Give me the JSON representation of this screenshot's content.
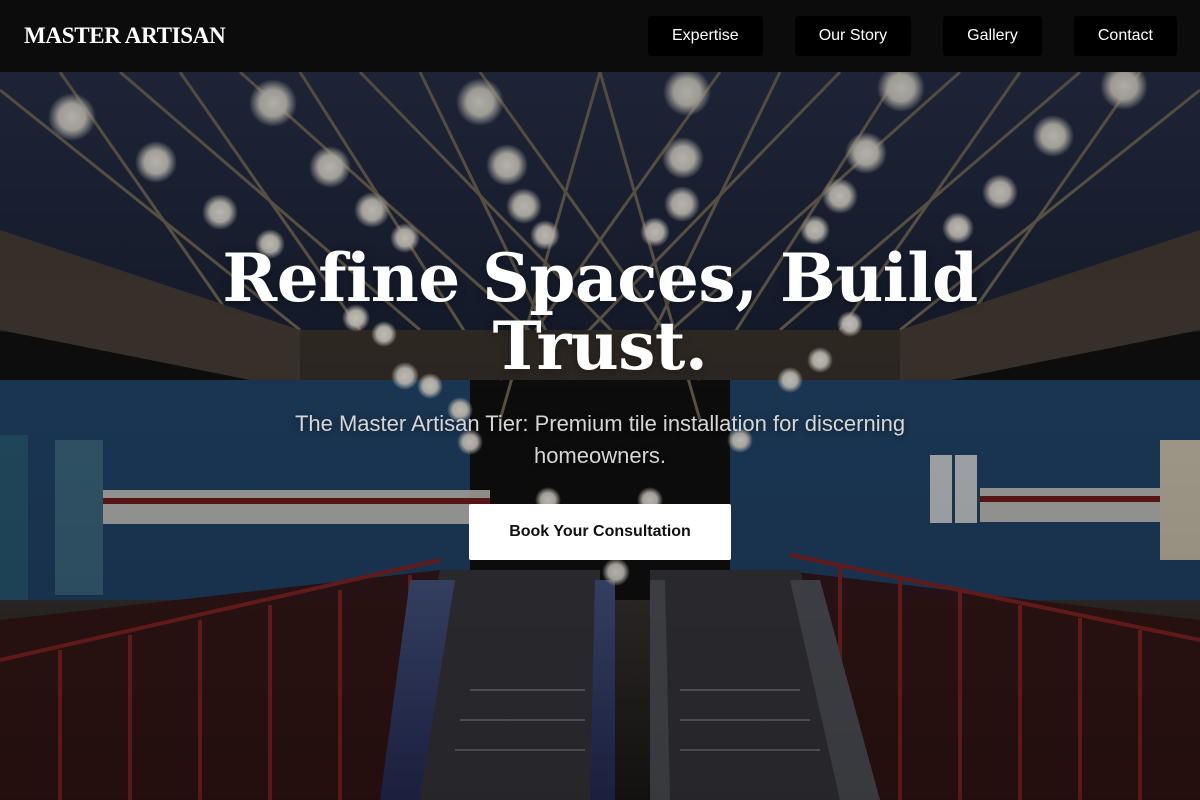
{
  "brand": {
    "name": "MASTER ARTISAN"
  },
  "nav": {
    "items": [
      {
        "label": "Expertise"
      },
      {
        "label": "Our Story"
      },
      {
        "label": "Gallery"
      },
      {
        "label": "Contact"
      }
    ]
  },
  "hero": {
    "title": "Refine Spaces, Build Trust.",
    "subtitle": "The Master Artisan Tier: Premium tile installation for discerning homeowners.",
    "cta_label": "Book Your Consultation"
  },
  "colors": {
    "nav_background": "#0c0c0d",
    "nav_button": "#000000",
    "text_primary": "#ffffff",
    "subtitle_text": "#d6d6d6",
    "cta_background": "#ffffff",
    "cta_text": "#111111",
    "ceiling_blue": "#1c2740",
    "wall_blue": "#27507e",
    "accent_red": "#7a1c1c"
  }
}
